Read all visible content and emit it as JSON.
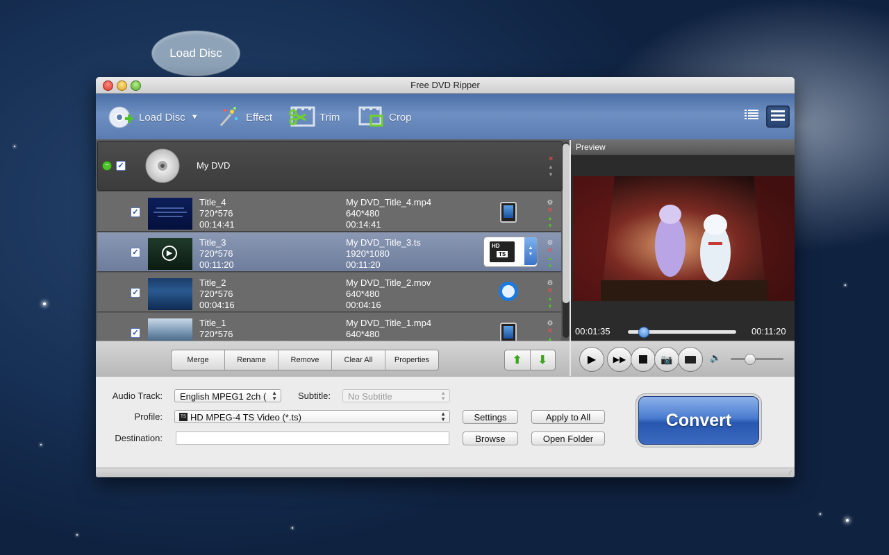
{
  "tooltip": {
    "label": "Load Disc"
  },
  "window": {
    "title": "Free DVD Ripper"
  },
  "toolbar": {
    "load_disc": "Load Disc",
    "effect": "Effect",
    "trim": "Trim",
    "crop": "Crop"
  },
  "disc": {
    "name": "My DVD"
  },
  "titles": [
    {
      "name": "Title_4",
      "resolution": "720*576",
      "duration": "00:14:41",
      "output_name": "My DVD_Title_4.mp4",
      "output_resolution": "640*480",
      "output_duration": "00:14:41",
      "format_icon": "ipad-icon"
    },
    {
      "name": "Title_3",
      "resolution": "720*576",
      "duration": "00:11:20",
      "output_name": "My DVD_Title_3.ts",
      "output_resolution": "1920*1080",
      "output_duration": "00:11:20",
      "format_icon": "hd-ts-icon"
    },
    {
      "name": "Title_2",
      "resolution": "720*576",
      "duration": "00:04:16",
      "output_name": "My DVD_Title_2.mov",
      "output_resolution": "640*480",
      "output_duration": "00:04:16",
      "format_icon": "quicktime-icon"
    },
    {
      "name": "Title_1",
      "resolution": "720*576",
      "duration": "",
      "output_name": "My DVD_Title_1.mp4",
      "output_resolution": "640*480",
      "output_duration": "",
      "format_icon": "ipad-icon"
    }
  ],
  "list_actions": {
    "merge": "Merge",
    "rename": "Rename",
    "remove": "Remove",
    "clear_all": "Clear All",
    "properties": "Properties"
  },
  "preview": {
    "heading": "Preview",
    "current_time": "00:01:35",
    "total_time": "00:11:20",
    "progress": 0.14,
    "volume": 0.35
  },
  "settings": {
    "audio_track_label": "Audio Track:",
    "audio_track_value": "English MPEG1 2ch (",
    "subtitle_label": "Subtitle:",
    "subtitle_value": "No Subtitle",
    "profile_label": "Profile:",
    "profile_value": "HD MPEG-4 TS Video (*.ts)",
    "destination_label": "Destination:",
    "destination_value": "",
    "settings_btn": "Settings",
    "apply_all_btn": "Apply to All",
    "browse_btn": "Browse",
    "open_folder_btn": "Open Folder",
    "convert_btn": "Convert"
  },
  "colors": {
    "accent": "#3c6ac0",
    "toolbar": "#5b7cb0",
    "selected_row": "#7b89a8"
  }
}
